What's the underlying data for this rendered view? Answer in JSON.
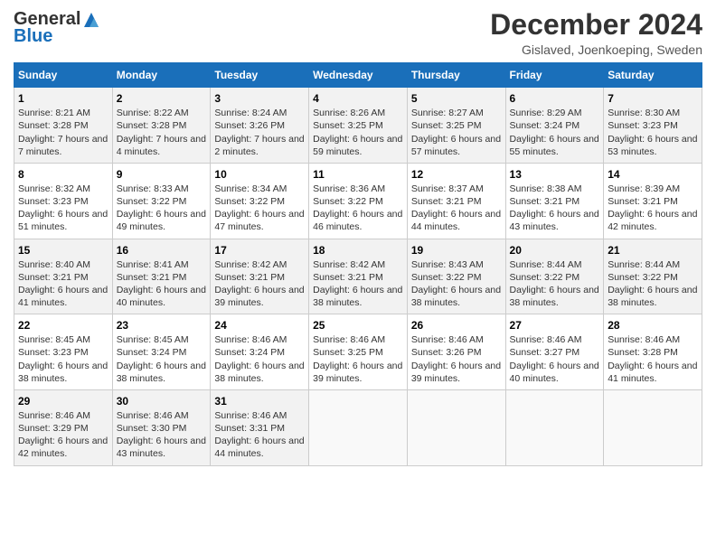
{
  "header": {
    "logo_general": "General",
    "logo_blue": "Blue",
    "title": "December 2024",
    "location": "Gislaved, Joenkoeping, Sweden"
  },
  "days_of_week": [
    "Sunday",
    "Monday",
    "Tuesday",
    "Wednesday",
    "Thursday",
    "Friday",
    "Saturday"
  ],
  "weeks": [
    [
      {
        "day": "1",
        "sunrise": "Sunrise: 8:21 AM",
        "sunset": "Sunset: 3:28 PM",
        "daylight": "Daylight: 7 hours and 7 minutes."
      },
      {
        "day": "2",
        "sunrise": "Sunrise: 8:22 AM",
        "sunset": "Sunset: 3:28 PM",
        "daylight": "Daylight: 7 hours and 4 minutes."
      },
      {
        "day": "3",
        "sunrise": "Sunrise: 8:24 AM",
        "sunset": "Sunset: 3:26 PM",
        "daylight": "Daylight: 7 hours and 2 minutes."
      },
      {
        "day": "4",
        "sunrise": "Sunrise: 8:26 AM",
        "sunset": "Sunset: 3:25 PM",
        "daylight": "Daylight: 6 hours and 59 minutes."
      },
      {
        "day": "5",
        "sunrise": "Sunrise: 8:27 AM",
        "sunset": "Sunset: 3:25 PM",
        "daylight": "Daylight: 6 hours and 57 minutes."
      },
      {
        "day": "6",
        "sunrise": "Sunrise: 8:29 AM",
        "sunset": "Sunset: 3:24 PM",
        "daylight": "Daylight: 6 hours and 55 minutes."
      },
      {
        "day": "7",
        "sunrise": "Sunrise: 8:30 AM",
        "sunset": "Sunset: 3:23 PM",
        "daylight": "Daylight: 6 hours and 53 minutes."
      }
    ],
    [
      {
        "day": "8",
        "sunrise": "Sunrise: 8:32 AM",
        "sunset": "Sunset: 3:23 PM",
        "daylight": "Daylight: 6 hours and 51 minutes."
      },
      {
        "day": "9",
        "sunrise": "Sunrise: 8:33 AM",
        "sunset": "Sunset: 3:22 PM",
        "daylight": "Daylight: 6 hours and 49 minutes."
      },
      {
        "day": "10",
        "sunrise": "Sunrise: 8:34 AM",
        "sunset": "Sunset: 3:22 PM",
        "daylight": "Daylight: 6 hours and 47 minutes."
      },
      {
        "day": "11",
        "sunrise": "Sunrise: 8:36 AM",
        "sunset": "Sunset: 3:22 PM",
        "daylight": "Daylight: 6 hours and 46 minutes."
      },
      {
        "day": "12",
        "sunrise": "Sunrise: 8:37 AM",
        "sunset": "Sunset: 3:21 PM",
        "daylight": "Daylight: 6 hours and 44 minutes."
      },
      {
        "day": "13",
        "sunrise": "Sunrise: 8:38 AM",
        "sunset": "Sunset: 3:21 PM",
        "daylight": "Daylight: 6 hours and 43 minutes."
      },
      {
        "day": "14",
        "sunrise": "Sunrise: 8:39 AM",
        "sunset": "Sunset: 3:21 PM",
        "daylight": "Daylight: 6 hours and 42 minutes."
      }
    ],
    [
      {
        "day": "15",
        "sunrise": "Sunrise: 8:40 AM",
        "sunset": "Sunset: 3:21 PM",
        "daylight": "Daylight: 6 hours and 41 minutes."
      },
      {
        "day": "16",
        "sunrise": "Sunrise: 8:41 AM",
        "sunset": "Sunset: 3:21 PM",
        "daylight": "Daylight: 6 hours and 40 minutes."
      },
      {
        "day": "17",
        "sunrise": "Sunrise: 8:42 AM",
        "sunset": "Sunset: 3:21 PM",
        "daylight": "Daylight: 6 hours and 39 minutes."
      },
      {
        "day": "18",
        "sunrise": "Sunrise: 8:42 AM",
        "sunset": "Sunset: 3:21 PM",
        "daylight": "Daylight: 6 hours and 38 minutes."
      },
      {
        "day": "19",
        "sunrise": "Sunrise: 8:43 AM",
        "sunset": "Sunset: 3:22 PM",
        "daylight": "Daylight: 6 hours and 38 minutes."
      },
      {
        "day": "20",
        "sunrise": "Sunrise: 8:44 AM",
        "sunset": "Sunset: 3:22 PM",
        "daylight": "Daylight: 6 hours and 38 minutes."
      },
      {
        "day": "21",
        "sunrise": "Sunrise: 8:44 AM",
        "sunset": "Sunset: 3:22 PM",
        "daylight": "Daylight: 6 hours and 38 minutes."
      }
    ],
    [
      {
        "day": "22",
        "sunrise": "Sunrise: 8:45 AM",
        "sunset": "Sunset: 3:23 PM",
        "daylight": "Daylight: 6 hours and 38 minutes."
      },
      {
        "day": "23",
        "sunrise": "Sunrise: 8:45 AM",
        "sunset": "Sunset: 3:24 PM",
        "daylight": "Daylight: 6 hours and 38 minutes."
      },
      {
        "day": "24",
        "sunrise": "Sunrise: 8:46 AM",
        "sunset": "Sunset: 3:24 PM",
        "daylight": "Daylight: 6 hours and 38 minutes."
      },
      {
        "day": "25",
        "sunrise": "Sunrise: 8:46 AM",
        "sunset": "Sunset: 3:25 PM",
        "daylight": "Daylight: 6 hours and 39 minutes."
      },
      {
        "day": "26",
        "sunrise": "Sunrise: 8:46 AM",
        "sunset": "Sunset: 3:26 PM",
        "daylight": "Daylight: 6 hours and 39 minutes."
      },
      {
        "day": "27",
        "sunrise": "Sunrise: 8:46 AM",
        "sunset": "Sunset: 3:27 PM",
        "daylight": "Daylight: 6 hours and 40 minutes."
      },
      {
        "day": "28",
        "sunrise": "Sunrise: 8:46 AM",
        "sunset": "Sunset: 3:28 PM",
        "daylight": "Daylight: 6 hours and 41 minutes."
      }
    ],
    [
      {
        "day": "29",
        "sunrise": "Sunrise: 8:46 AM",
        "sunset": "Sunset: 3:29 PM",
        "daylight": "Daylight: 6 hours and 42 minutes."
      },
      {
        "day": "30",
        "sunrise": "Sunrise: 8:46 AM",
        "sunset": "Sunset: 3:30 PM",
        "daylight": "Daylight: 6 hours and 43 minutes."
      },
      {
        "day": "31",
        "sunrise": "Sunrise: 8:46 AM",
        "sunset": "Sunset: 3:31 PM",
        "daylight": "Daylight: 6 hours and 44 minutes."
      },
      null,
      null,
      null,
      null
    ]
  ]
}
